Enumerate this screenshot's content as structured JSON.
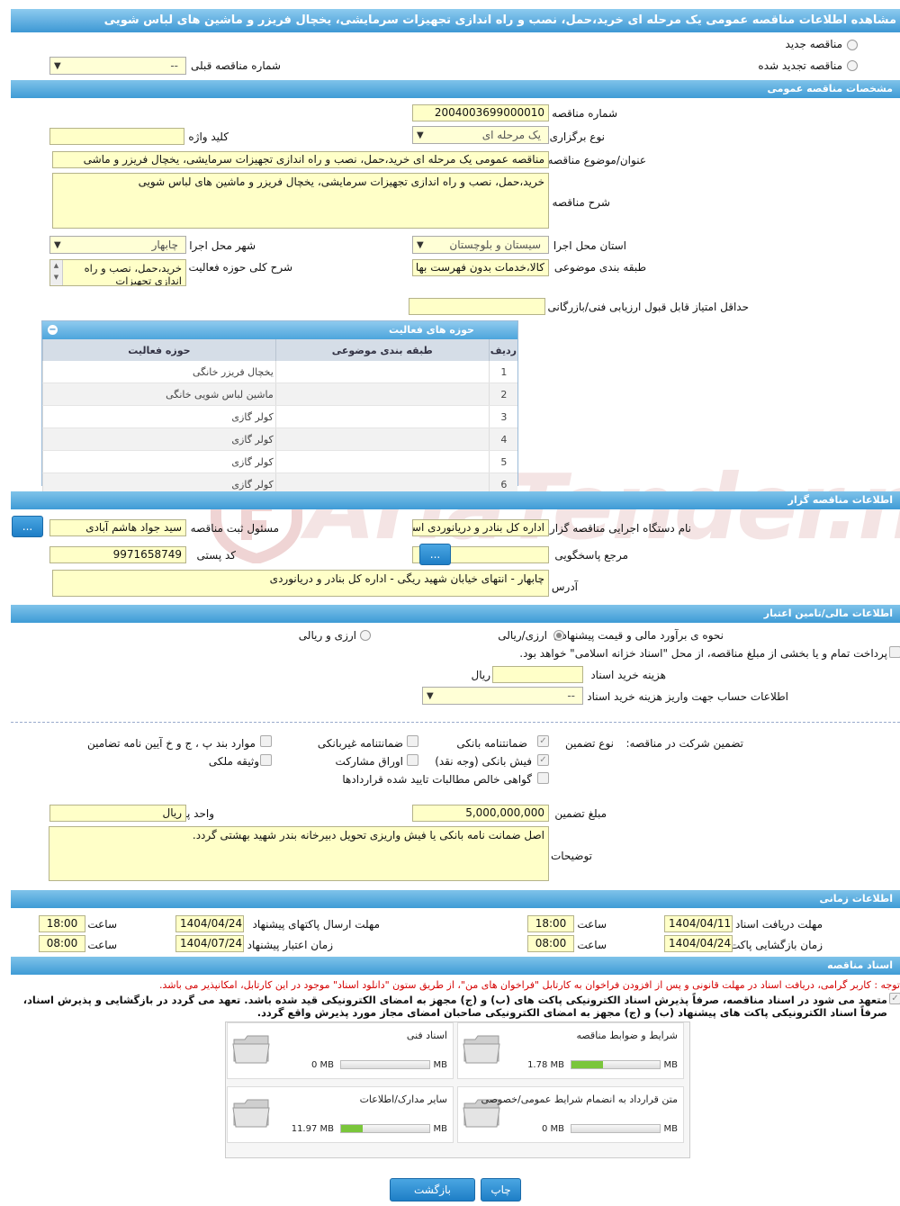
{
  "page_title": "مشاهده اطلاعات مناقصه عمومی یک مرحله ای خرید،حمل، نصب و راه اندازی تجهیزات سرمایشی، یخچال فریزر و ماشین های لباس شویی",
  "top": {
    "radio_new": "مناقصه جدید",
    "radio_renewed": "مناقصه تجدید شده",
    "prev_tender_label": "شماره مناقصه قبلی",
    "prev_tender_value": "--"
  },
  "general": {
    "header": "مشخصات مناقصه عمومی",
    "tender_no_label": "شماره مناقصه",
    "tender_no": "2004003699000010",
    "type_label": "نوع برگزاری",
    "type_value": "یک مرحله ای",
    "keyword_label": "کلید واژه",
    "keyword_value": "",
    "subject_label": "عنوان/موضوع مناقصه",
    "subject_value": "مناقصه عمومی یک مرحله ای خرید،حمل، نصب و راه اندازی تجهیزات سرمایشی، یخچال فریزر و ماشی",
    "desc_label": "شرح مناقصه",
    "desc_value": "خرید،حمل، نصب و راه اندازی تجهیزات سرمایشی، یخچال فریزر و ماشین های لباس شویی",
    "province_label": "استان محل اجرا",
    "province_value": "سیستان و بلوچستان",
    "city_label": "شهر محل اجرا",
    "city_value": "چابهار",
    "category_label": "طبقه بندی موضوعی",
    "category_value": "کالا،خدمات بدون فهرست بها",
    "scope_label": "شرح کلی حوزه فعالیت",
    "scope_value": "خرید،حمل، نصب و راه اندازی تجهیزات",
    "min_score_label": "حداقل امتیاز قابل قبول ارزیابی فنی/بازرگانی",
    "min_score_value": ""
  },
  "activities": {
    "header": "حوزه های فعالیت",
    "col_row": "ردیف",
    "col_category": "طبقه بندی موضوعی",
    "col_field": "حوزه فعالیت",
    "rows": [
      {
        "n": "1",
        "category": "",
        "field": "یخچال فریزر خانگی"
      },
      {
        "n": "2",
        "category": "",
        "field": "ماشین لباس شویی خانگی"
      },
      {
        "n": "3",
        "category": "",
        "field": "کولر گازی"
      },
      {
        "n": "4",
        "category": "",
        "field": "کولر گازی"
      },
      {
        "n": "5",
        "category": "",
        "field": "کولر گازی"
      },
      {
        "n": "6",
        "category": "",
        "field": "کولر گازی"
      }
    ]
  },
  "organizer": {
    "header": "اطلاعات مناقصه گزار",
    "org_label": "نام دستگاه اجرایی مناقصه گزار",
    "org_value": "اداره کل بنادر و دریانوردی استان",
    "responsible_label": "مسئول ثبت مناقصه",
    "responsible_value": "سید جواد هاشم آبادی",
    "ref_label": "مرجع پاسخگویی",
    "postal_label": "کد پستی",
    "postal_value": "9971658749",
    "address_label": "آدرس",
    "address_value": "چابهار - انتهای خیابان شهید ریگی - اداره کل بنادر و دریانوردی",
    "dots": "..."
  },
  "finance": {
    "header": "اطلاعات مالی/تامین اعتبار",
    "estimate_label": "نحوه ی برآورد مالی و قیمت پیشنهادی",
    "opt_rial": "ارزی/ریالی",
    "opt_fx": "ارزی و ریالی",
    "treasury_text": "پرداخت تمام و یا بخشی از مبلغ مناقصه، از محل \"اسناد خزانه اسلامی\" خواهد بود.",
    "doc_cost_label": "هزینه خرید اسناد",
    "doc_cost_unit": "ریال",
    "account_label": "اطلاعات حساب جهت واریز هزینه خرید اسناد",
    "account_value": "--"
  },
  "guarantee": {
    "label": "تضمین شرکت در مناقصه:",
    "type_label": "نوع تضمین",
    "opts": {
      "bank_guarantee": "ضمانتنامه بانکی",
      "nonbank_guarantee": "ضمانتنامه غیربانکی",
      "clauses": "موارد بند پ ، ج و خ آیین نامه تضامین",
      "bank_receipt": "فیش بانکی (وجه نقد)",
      "bonds": "اوراق مشارکت",
      "property": "وثیقه ملکی",
      "claims": "گواهی خالص مطالبات تایید شده قراردادها"
    },
    "amount_label": "مبلغ تضمین",
    "amount_value": "5,000,000,000",
    "currency_label": "واحد پول",
    "currency_value": "ریال",
    "notes_label": "توضیحات",
    "notes_value": "اصل ضمانت نامه بانکی یا فیش واریزی تحویل دبیرخانه بندر شهید بهشتی گردد."
  },
  "timing": {
    "header": "اطلاعات زمانی",
    "receive_label": "مهلت دریافت اسناد",
    "receive_date": "1404/04/11",
    "receive_time": "18:00",
    "send_label": "مهلت ارسال پاکتهای پیشنهاد",
    "send_date": "1404/04/24",
    "send_time": "18:00",
    "open_label": "زمان بازگشایی پاکت ها",
    "open_date": "1404/04/24",
    "open_time": "08:00",
    "valid_label": "زمان اعتبار پیشنهاد",
    "valid_date": "1404/07/24",
    "valid_time": "08:00",
    "time_word": "ساعت"
  },
  "docs": {
    "header": "اسناد مناقصه",
    "notice": "توجه : کاربر گرامی، دریافت اسناد در مهلت قانونی و پس از افزودن فراخوان به کارتابل \"فراخوان های من\"، از طریق ستون \"دانلود اسناد\" موجود در این کارتابل، امکانپذیر می باشد.",
    "commit_1": "متعهد می شود در اسناد مناقصه، صرفاً پذیرش اسناد الکترونیکی پاکت های (ب) و (ج) مجهز به امضای الکترونیکی قید شده باشد. تعهد می گردد در بازگشایی و پذیرش اسناد،",
    "commit_2": "صرفاً اسناد الکترونیکی پاکت های پیشنهاد (ب) و (ج) مجهز به امضای الکترونیکی صاحبان امضای مجاز مورد پذیرش واقع گردد.",
    "files": [
      {
        "title": "شرایط و ضوابط مناقصه",
        "size": "1.78 MB",
        "max": "5 MB",
        "fill": 0.36
      },
      {
        "title": "اسناد فنی",
        "size": "0 MB",
        "max": "50 MB",
        "fill": 0
      },
      {
        "title": "متن قرارداد به انضمام شرایط عمومی/خصوصی",
        "size": "0 MB",
        "max": "5 MB",
        "fill": 0
      },
      {
        "title": "سایر مدارک/اطلاعات",
        "size": "11.97 MB",
        "max": "50 MB",
        "fill": 0.24
      }
    ]
  },
  "footer": {
    "print": "چاپ",
    "back": "بازگشت"
  },
  "watermark": "AriaTender.neT"
}
